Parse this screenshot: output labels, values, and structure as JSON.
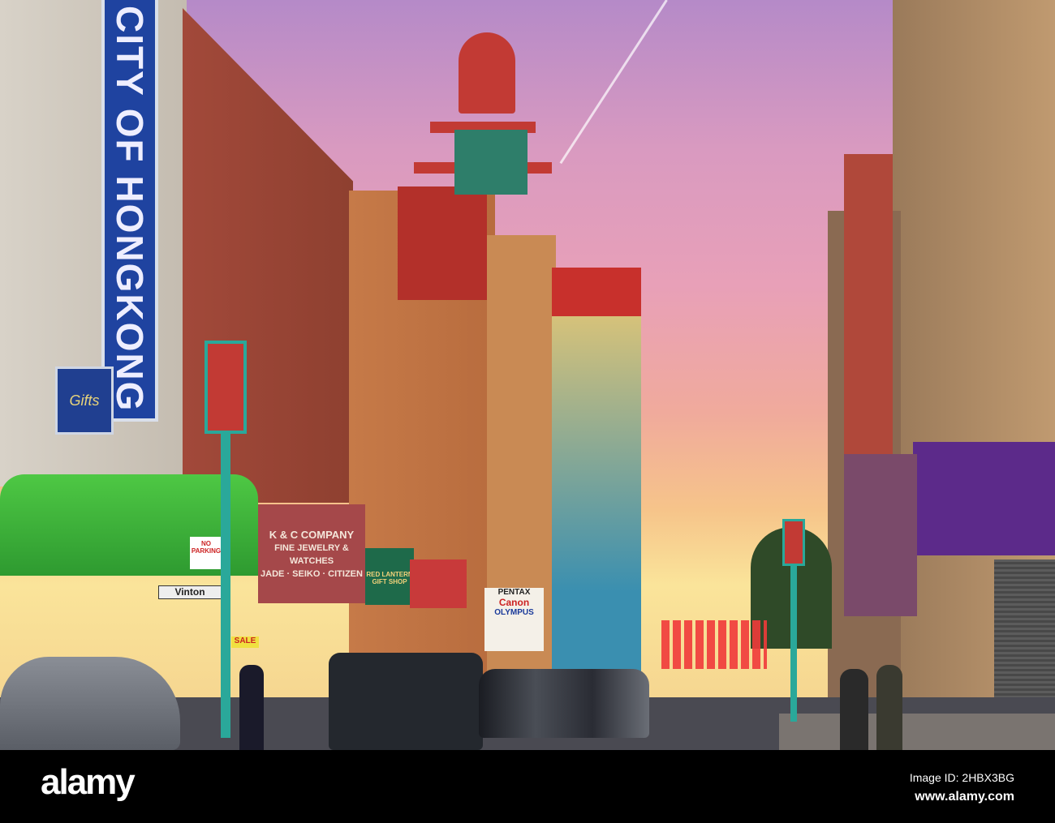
{
  "photo": {
    "signs": {
      "hongkong": "CITY OF HONGKONG",
      "gifts": "Gifts",
      "kc_company": "K & C COMPANY",
      "kc_line2": "FINE JEWELRY & WATCHES",
      "kc_line3": "JADE · SEIKO · CITIZEN",
      "no_parking": "NO PARKING",
      "street": "Vinton",
      "pentax": "PENTAX",
      "canon": "Canon",
      "olympus": "OLYMPUS",
      "sale": "SALE",
      "lanterns": "RED LANTERN GIFT SHOP"
    },
    "colors": {
      "sky_top": "#b58ac8",
      "sky_bottom": "#fae49a",
      "sign_blue": "#1f43a0",
      "awning_green": "#3fae3a",
      "lamp_teal": "#2aa89a"
    }
  },
  "watermark": {
    "brand": "alamy",
    "image_id": "Image ID: 2HBX3BG",
    "url": "www.alamy.com"
  }
}
